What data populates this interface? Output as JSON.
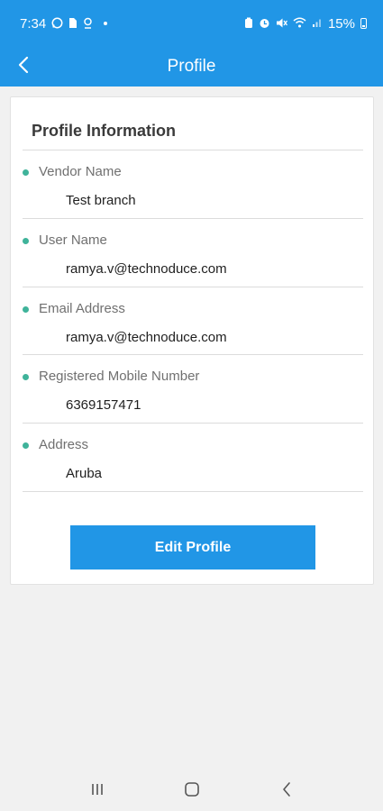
{
  "status_bar": {
    "time": "7:34",
    "battery_text": "15%",
    "left_icons": [
      "whatsapp-icon",
      "sim-icon",
      "location-icon"
    ],
    "right_icons": [
      "battery-saver-icon",
      "alarm-icon",
      "mute-icon",
      "wifi-icon",
      "signal-icon"
    ]
  },
  "header": {
    "title": "Profile",
    "background_color": "#2196e6"
  },
  "profile": {
    "section_title": "Profile Information",
    "fields": [
      {
        "label": "Vendor Name",
        "value": "Test branch"
      },
      {
        "label": "User Name",
        "value": "ramya.v@technoduce.com"
      },
      {
        "label": "Email Address",
        "value": "ramya.v@technoduce.com"
      },
      {
        "label": "Registered Mobile Number",
        "value": "6369157471"
      },
      {
        "label": "Address",
        "value": "Aruba"
      }
    ],
    "bullet_color": "#3fb39a",
    "edit_button_label": "Edit Profile"
  },
  "nav_bar": {
    "icons": [
      "recent-apps-icon",
      "home-icon",
      "back-icon"
    ]
  }
}
